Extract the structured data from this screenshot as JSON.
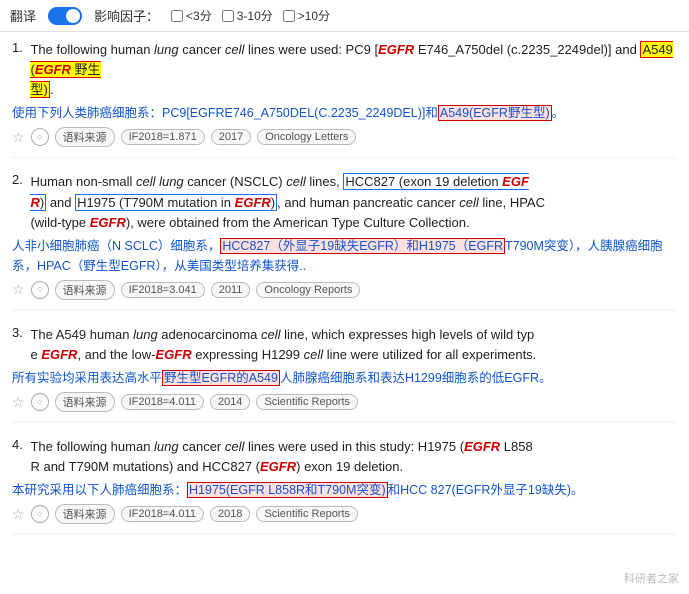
{
  "topBar": {
    "translateLabel": "翻译",
    "impactLabel": "影响因子：",
    "filters": [
      {
        "label": "<3分",
        "checked": false
      },
      {
        "label": "3-10分",
        "checked": false
      },
      {
        " label": ">10分",
        "checked": false
      }
    ]
  },
  "results": [
    {
      "number": "1.",
      "englishText": "The following human lung cancer cell lines were used: PC9 [EGFR E746_A750del (c.2235_2249del)] and A549 (EGFR wild-type).",
      "chineseText": "使用下列人类肺癌细胞系：PC9[EGFRE746_A750DEL(C.2235_2249DEL)]和A549(EGFR野生型)。",
      "meta": {
        "sourceLabel": "语料来源",
        "if": "IF2018=1.871",
        "year": "2017",
        "journal": "Oncology Letters"
      }
    },
    {
      "number": "2.",
      "englishText": "Human non-small cell lung cancer (NSCLC) cell lines, HCC827 (exon 19 deletion EGFR) and H1975 (T790M mutation in EGFR), and human pancreatic cancer cell line, HPAC (wild-type EGFR), were obtained from the American Type Culture Collection.",
      "chineseText": "人非小细胞肺癌（N SCLC）细胞系，HCC827（外显子19缺失EGFR）和H1975（EGFR T790M突变），人胰腺癌细胞系，HPAC（野生型EGFR），从美国类型培养集获得..",
      "meta": {
        "sourceLabel": "语料来源",
        "if": "IF2018=3.041",
        "year": "2011",
        "journal": "Oncology Reports"
      }
    },
    {
      "number": "3.",
      "englishText": "The A549 human lung adenocarcinoma cell line, which expresses high levels of wild type EGFR, and the low-EGFR expressing H1299 cell line were utilized for all experiments.",
      "chineseText": "所有实验均采用表达高水平野生型EGFR的A549人肺腺癌细胞系和表达H1299细胞系的低EGFR。",
      "meta": {
        "sourceLabel": "语料来源",
        "if": "IF2018=4.011",
        "year": "2014",
        "journal": "Scientific Reports"
      }
    },
    {
      "number": "4.",
      "englishText": "The following human lung cancer cell lines were used in this study: H1975 (EGFR L858R and T790M mutations) and HCC827 (EGFR exon 19 deletion.",
      "chineseText": "本研究采用以下人肺癌细胞系：H1975(EGFR L858R和T790M突变)和HCC 827(EGFR外显子19缺失)。",
      "meta": {
        "sourceLabel": "语料来源",
        "if": "IF2018=4.011",
        "year": "2018",
        "journal": "Scientific Reports"
      }
    }
  ],
  "watermark": "科研者之家"
}
